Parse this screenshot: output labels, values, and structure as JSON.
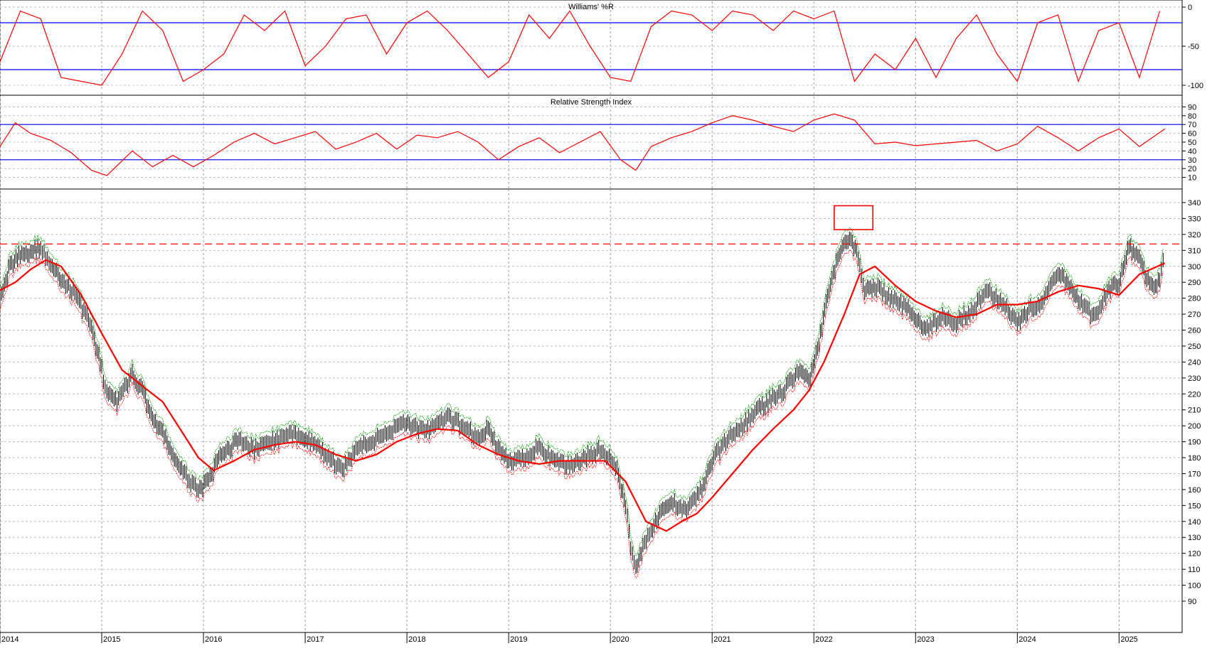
{
  "chart_data": [
    {
      "panel": "williams-r",
      "type": "line",
      "title": "Williams' %R",
      "ylim": [
        -100,
        0
      ],
      "yticks": [
        0,
        -50,
        -100
      ],
      "reference_lines": [
        -20,
        -80
      ],
      "series": [
        {
          "color": "#ff0000",
          "x": [
            2014.0,
            2014.2,
            2014.4,
            2014.6,
            2014.8,
            2015.0,
            2015.2,
            2015.4,
            2015.6,
            2015.8,
            2016.0,
            2016.2,
            2016.4,
            2016.6,
            2016.8,
            2017.0,
            2017.2,
            2017.4,
            2017.6,
            2017.8,
            2018.0,
            2018.2,
            2018.4,
            2018.6,
            2018.8,
            2019.0,
            2019.2,
            2019.4,
            2019.6,
            2019.8,
            2020.0,
            2020.2,
            2020.4,
            2020.6,
            2020.8,
            2021.0,
            2021.2,
            2021.4,
            2021.6,
            2021.8,
            2022.0,
            2022.2,
            2022.4,
            2022.6,
            2022.8,
            2023.0,
            2023.2,
            2023.4,
            2023.6,
            2023.8,
            2024.0,
            2024.2,
            2024.4,
            2024.6,
            2024.8,
            2025.0,
            2025.2,
            2025.4
          ],
          "values": [
            -70,
            -5,
            -15,
            -90,
            -95,
            -100,
            -60,
            -5,
            -30,
            -95,
            -80,
            -60,
            -10,
            -30,
            -5,
            -75,
            -50,
            -15,
            -10,
            -60,
            -20,
            -5,
            -30,
            -60,
            -90,
            -70,
            -10,
            -40,
            -5,
            -50,
            -90,
            -95,
            -25,
            -5,
            -10,
            -30,
            -5,
            -10,
            -30,
            -5,
            -15,
            -5,
            -95,
            -60,
            -80,
            -40,
            -90,
            -40,
            -10,
            -60,
            -95,
            -20,
            -10,
            -95,
            -30,
            -20,
            -90,
            -5
          ]
        }
      ]
    },
    {
      "panel": "rsi",
      "type": "line",
      "title": "Relative Strength Index",
      "ylim": [
        0,
        100
      ],
      "yticks": [
        90,
        80,
        70,
        60,
        50,
        40,
        30,
        20,
        10
      ],
      "reference_lines": [
        70,
        30
      ],
      "series": [
        {
          "color": "#ff0000",
          "x": [
            2014.0,
            2014.15,
            2014.3,
            2014.5,
            2014.7,
            2014.9,
            2015.05,
            2015.3,
            2015.5,
            2015.7,
            2015.9,
            2016.1,
            2016.3,
            2016.5,
            2016.7,
            2016.9,
            2017.1,
            2017.3,
            2017.5,
            2017.7,
            2017.9,
            2018.1,
            2018.3,
            2018.5,
            2018.7,
            2018.9,
            2019.1,
            2019.3,
            2019.5,
            2019.7,
            2019.9,
            2020.1,
            2020.25,
            2020.4,
            2020.6,
            2020.8,
            2021.0,
            2021.2,
            2021.4,
            2021.6,
            2021.8,
            2022.0,
            2022.2,
            2022.4,
            2022.6,
            2022.8,
            2023.0,
            2023.2,
            2023.4,
            2023.6,
            2023.8,
            2024.0,
            2024.2,
            2024.4,
            2024.6,
            2024.8,
            2025.0,
            2025.2,
            2025.45
          ],
          "values": [
            45,
            72,
            60,
            52,
            38,
            18,
            12,
            40,
            22,
            35,
            22,
            35,
            50,
            60,
            48,
            55,
            62,
            42,
            50,
            60,
            42,
            58,
            55,
            62,
            50,
            30,
            45,
            55,
            38,
            50,
            62,
            30,
            18,
            45,
            55,
            62,
            72,
            80,
            75,
            68,
            62,
            75,
            82,
            75,
            48,
            50,
            46,
            48,
            50,
            52,
            40,
            48,
            68,
            55,
            40,
            55,
            65,
            45,
            65
          ]
        }
      ]
    },
    {
      "panel": "price",
      "type": "line",
      "ylim": [
        90,
        340
      ],
      "yticks": [
        340,
        330,
        320,
        310,
        300,
        290,
        280,
        270,
        260,
        250,
        240,
        230,
        220,
        210,
        200,
        190,
        180,
        170,
        160,
        150,
        140,
        130,
        120,
        110,
        100,
        90
      ],
      "xticks": [
        "2014",
        "2015",
        "2016",
        "2017",
        "2018",
        "2019",
        "2020",
        "2021",
        "2022",
        "2023",
        "2024",
        "2025"
      ],
      "xlim": [
        2014.0,
        2025.62
      ],
      "horizontal_line": {
        "value": 314,
        "color": "#ff0000",
        "style": "dashed"
      },
      "highlight_box": {
        "x": [
          2022.2,
          2022.58
        ],
        "y": [
          323,
          338
        ],
        "color": "#ff0000"
      },
      "series": [
        {
          "name": "",
          "style": "price-bars",
          "color": "#000000",
          "x": [
            2014.0,
            2014.1,
            2014.2,
            2014.3,
            2014.4,
            2014.45,
            2014.5,
            2014.6,
            2014.75,
            2014.9,
            2015.0,
            2015.05,
            2015.15,
            2015.3,
            2015.4,
            2015.5,
            2015.6,
            2015.7,
            2015.8,
            2015.95,
            2016.05,
            2016.15,
            2016.25,
            2016.35,
            2016.5,
            2016.65,
            2016.8,
            2016.95,
            2017.05,
            2017.2,
            2017.35,
            2017.5,
            2017.65,
            2017.8,
            2017.95,
            2018.1,
            2018.25,
            2018.4,
            2018.55,
            2018.7,
            2018.8,
            2018.9,
            2019.0,
            2019.15,
            2019.3,
            2019.45,
            2019.6,
            2019.75,
            2019.9,
            2020.05,
            2020.15,
            2020.2,
            2020.25,
            2020.32,
            2020.4,
            2020.5,
            2020.6,
            2020.75,
            2020.9,
            2021.0,
            2021.15,
            2021.3,
            2021.45,
            2021.55,
            2021.7,
            2021.85,
            2021.95,
            2022.05,
            2022.15,
            2022.25,
            2022.35,
            2022.42,
            2022.5,
            2022.6,
            2022.75,
            2022.9,
            2023.0,
            2023.1,
            2023.25,
            2023.4,
            2023.55,
            2023.7,
            2023.85,
            2024.0,
            2024.1,
            2024.25,
            2024.4,
            2024.5,
            2024.6,
            2024.75,
            2024.9,
            2025.0,
            2025.1,
            2025.2,
            2025.3,
            2025.4,
            2025.45
          ],
          "values": [
            282,
            300,
            308,
            309,
            312,
            305,
            300,
            292,
            282,
            262,
            235,
            220,
            215,
            232,
            222,
            205,
            195,
            182,
            170,
            160,
            165,
            180,
            185,
            192,
            185,
            190,
            193,
            195,
            190,
            182,
            172,
            185,
            190,
            195,
            203,
            198,
            198,
            205,
            200,
            192,
            198,
            185,
            178,
            180,
            187,
            177,
            175,
            180,
            185,
            175,
            150,
            125,
            110,
            125,
            135,
            145,
            152,
            148,
            160,
            178,
            192,
            200,
            210,
            215,
            222,
            235,
            228,
            252,
            285,
            308,
            318,
            310,
            285,
            288,
            280,
            275,
            268,
            260,
            268,
            265,
            272,
            285,
            278,
            265,
            272,
            278,
            295,
            290,
            278,
            268,
            285,
            290,
            312,
            305,
            288,
            290,
            310
          ]
        },
        {
          "name": "",
          "style": "moving-average",
          "color": "#ff0000",
          "x": [
            2014.0,
            2014.15,
            2014.3,
            2014.45,
            2014.6,
            2014.8,
            2015.0,
            2015.2,
            2015.4,
            2015.6,
            2015.8,
            2015.95,
            2016.1,
            2016.3,
            2016.5,
            2016.7,
            2016.9,
            2017.1,
            2017.3,
            2017.5,
            2017.7,
            2017.9,
            2018.1,
            2018.3,
            2018.5,
            2018.7,
            2018.9,
            2019.1,
            2019.3,
            2019.5,
            2019.7,
            2019.95,
            2020.15,
            2020.35,
            2020.55,
            2020.7,
            2020.85,
            2021.0,
            2021.2,
            2021.4,
            2021.6,
            2021.8,
            2021.95,
            2022.1,
            2022.3,
            2022.45,
            2022.6,
            2022.8,
            2023.0,
            2023.2,
            2023.4,
            2023.6,
            2023.8,
            2024.0,
            2024.2,
            2024.4,
            2024.6,
            2024.8,
            2025.0,
            2025.2,
            2025.45
          ],
          "values": [
            285,
            290,
            298,
            304,
            300,
            282,
            258,
            235,
            225,
            215,
            195,
            180,
            172,
            178,
            185,
            188,
            190,
            188,
            182,
            178,
            182,
            190,
            195,
            198,
            197,
            188,
            182,
            178,
            176,
            178,
            178,
            178,
            165,
            140,
            134,
            140,
            145,
            155,
            170,
            185,
            198,
            210,
            222,
            240,
            270,
            295,
            300,
            288,
            278,
            272,
            268,
            270,
            276,
            276,
            278,
            284,
            288,
            286,
            282,
            295,
            302
          ]
        }
      ]
    }
  ],
  "labels": {
    "williams_title": "Williams' %R",
    "rsi_title": "Relative Strength Index"
  }
}
